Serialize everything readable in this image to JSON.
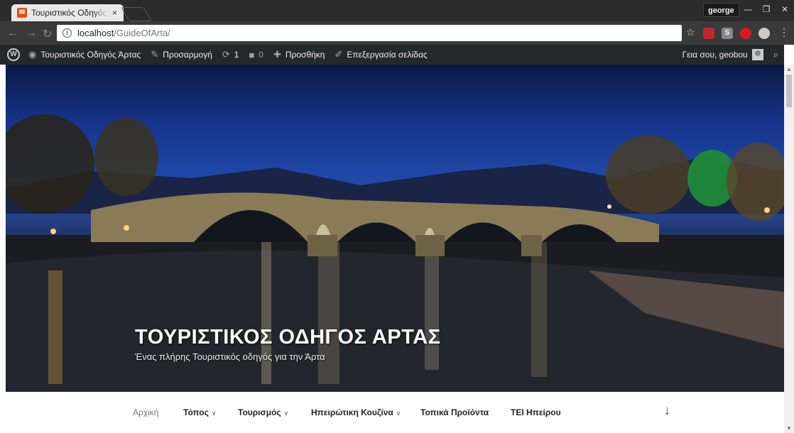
{
  "browser": {
    "tab_title": "Τουριστικός Οδηγός Άρτας",
    "tab_close": "×",
    "profile_name": "george",
    "url_host": "localhost",
    "url_path": "/GuideOfArta/"
  },
  "adminbar": {
    "site_name": "Τουριστικός Οδηγός Άρτας",
    "customize": "Προσαρμογή",
    "updates_count": "1",
    "comments_count": "0",
    "new": "Προσθήκη",
    "edit_page": "Επεξεργασία σελίδας",
    "greeting": "Γεια σου, geobou"
  },
  "hero": {
    "title": "ΤΟΥΡΙΣΤΙΚΟΣ ΟΔΗΓΟΣ ΑΡΤΑΣ",
    "subtitle": "Ένας πλήρης Τουριστικός οδηγός για την Άρτα"
  },
  "nav": {
    "items": [
      {
        "label": "Αρχική"
      },
      {
        "label": "Τόπος"
      },
      {
        "label": "Τουρισμός"
      },
      {
        "label": "Ηπειρώτικη Κουζίνα"
      },
      {
        "label": "Τοπικά Προϊόντα"
      },
      {
        "label": "ΤΕΙ Ηπείρου"
      }
    ],
    "scroll_arrow": "↓"
  }
}
